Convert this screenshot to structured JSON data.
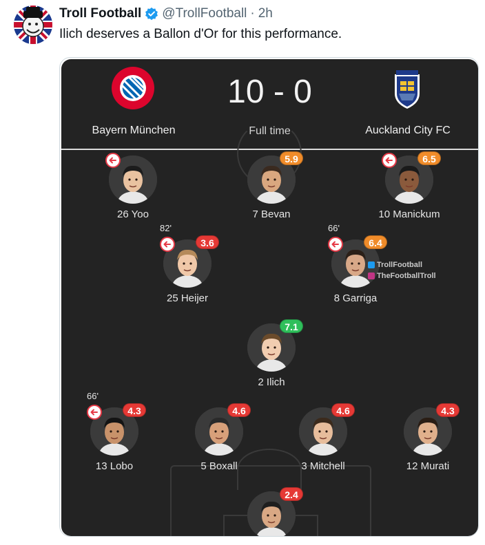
{
  "tweet": {
    "display_name": "Troll Football",
    "handle": "@TrollFootball",
    "separator": "·",
    "time": "2h",
    "text": "Ilich deserves a Ballon d'Or for this performance.",
    "avatar_icon": "troll-face-union-jack-avatar"
  },
  "match": {
    "home_team": "Bayern München",
    "away_team": "Auckland City FC",
    "score": "10 - 0",
    "status": "Full time"
  },
  "colors": {
    "rating_red": "#e53935",
    "rating_orange": "#f08c2a",
    "rating_green": "#2fbf5b",
    "panel_bg": "#232323",
    "verified_blue": "#1d9bf0"
  },
  "players": [
    {
      "id": "yoo",
      "label": "26 Yoo",
      "rating": "",
      "rating_color": "",
      "minute": "",
      "subbed": true
    },
    {
      "id": "bevan",
      "label": "7 Bevan",
      "rating": "5.9",
      "rating_color": "#f08c2a",
      "minute": "",
      "subbed": false
    },
    {
      "id": "manickum",
      "label": "10 Manickum",
      "rating": "6.5",
      "rating_color": "#f08c2a",
      "minute": "",
      "subbed": true
    },
    {
      "id": "heijer",
      "label": "25 Heijer",
      "rating": "3.6",
      "rating_color": "#e53935",
      "minute": "82'",
      "subbed": true
    },
    {
      "id": "garriga",
      "label": "8 Garriga",
      "rating": "6.4",
      "rating_color": "#f08c2a",
      "minute": "66'",
      "subbed": true
    },
    {
      "id": "ilich",
      "label": "2 Ilich",
      "rating": "7.1",
      "rating_color": "#2fbf5b",
      "minute": "",
      "subbed": false
    },
    {
      "id": "lobo",
      "label": "13 Lobo",
      "rating": "4.3",
      "rating_color": "#e53935",
      "minute": "66'",
      "subbed": true
    },
    {
      "id": "boxall",
      "label": "5 Boxall",
      "rating": "4.6",
      "rating_color": "#e53935",
      "minute": "",
      "subbed": false
    },
    {
      "id": "mitchell",
      "label": "3 Mitchell",
      "rating": "4.6",
      "rating_color": "#e53935",
      "minute": "",
      "subbed": false
    },
    {
      "id": "murati",
      "label": "12 Murati",
      "rating": "4.3",
      "rating_color": "#e53935",
      "minute": "",
      "subbed": false
    },
    {
      "id": "goalkeeper",
      "label": "",
      "rating": "2.4",
      "rating_color": "#e53935",
      "minute": "",
      "subbed": false
    }
  ],
  "watermark": {
    "twitter": "TrollFootball",
    "instagram": "TheFootballTroll"
  }
}
